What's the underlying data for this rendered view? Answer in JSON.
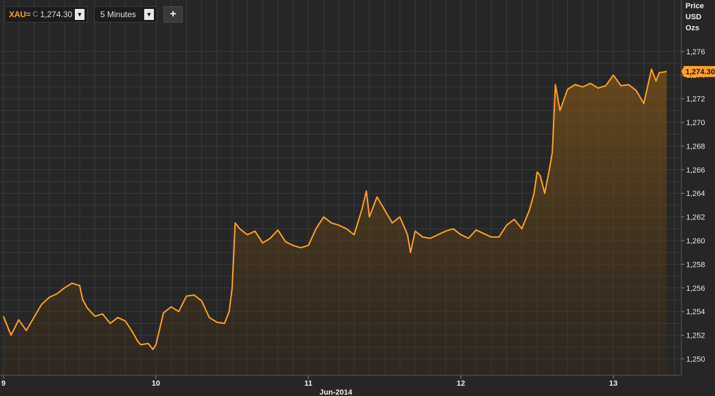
{
  "toolbar": {
    "ric": "XAU=",
    "closing_marker": "C",
    "last_price": "1,274.30",
    "interval": "5 Minutes",
    "add_label": "+"
  },
  "axis_header": {
    "line1": "Price",
    "line2": "USD",
    "line3": "Ozs"
  },
  "colors": {
    "line": "#ffa126",
    "background": "#262626",
    "grid": "#3a3a3a",
    "last_price_badge": "#ffa126"
  },
  "chart_data": {
    "type": "area",
    "title": "",
    "xlabel": "Jun-2014",
    "ylabel": "Price USD Ozs",
    "x_ticks": [
      "9",
      "10",
      "11",
      "12",
      "13"
    ],
    "ylim": [
      1249,
      1277
    ],
    "y_ticks": [
      "1,250",
      "1,252",
      "1,254",
      "1,256",
      "1,258",
      "1,260",
      "1,262",
      "1,264",
      "1,266",
      "1,268",
      "1,270",
      "1,272",
      "1,274",
      "1,276"
    ],
    "last_value": 1274.3,
    "last_value_label": "1,274.30",
    "grid": true,
    "series": [
      {
        "x": [
          9.0,
          9.05,
          9.1,
          9.15,
          9.2,
          9.25,
          9.3,
          9.35,
          9.4,
          9.45,
          9.5,
          9.52,
          9.55,
          9.6,
          9.65,
          9.7,
          9.75,
          9.8,
          9.85,
          9.88,
          9.9,
          9.95,
          9.98,
          10.0,
          10.05,
          10.1,
          10.15,
          10.2,
          10.25,
          10.3,
          10.35,
          10.4,
          10.45,
          10.48,
          10.5,
          10.52,
          10.55,
          10.6,
          10.65,
          10.7,
          10.75,
          10.8,
          10.85,
          10.9,
          10.95,
          11.0,
          11.05,
          11.1,
          11.15,
          11.2,
          11.25,
          11.3,
          11.35,
          11.38,
          11.4,
          11.45,
          11.5,
          11.55,
          11.6,
          11.65,
          11.67,
          11.7,
          11.75,
          11.8,
          11.85,
          11.9,
          11.95,
          12.0,
          12.05,
          12.1,
          12.15,
          12.2,
          12.25,
          12.3,
          12.35,
          12.4,
          12.45,
          12.48,
          12.5,
          12.52,
          12.55,
          12.58,
          12.6,
          12.62,
          12.65,
          12.7,
          12.75,
          12.8,
          12.85,
          12.9,
          12.95,
          13.0,
          13.05,
          13.1,
          13.15,
          13.2,
          13.25,
          13.28,
          13.3,
          13.35
        ],
        "values": [
          1253.6,
          1252.0,
          1253.3,
          1252.4,
          1253.5,
          1254.6,
          1255.2,
          1255.5,
          1256.0,
          1256.4,
          1256.2,
          1255.0,
          1254.3,
          1253.6,
          1253.8,
          1253.0,
          1253.5,
          1253.2,
          1252.2,
          1251.5,
          1251.2,
          1251.3,
          1250.8,
          1251.2,
          1253.9,
          1254.4,
          1254.0,
          1255.3,
          1255.4,
          1254.9,
          1253.5,
          1253.1,
          1253.0,
          1254.0,
          1256.0,
          1261.5,
          1261.0,
          1260.5,
          1260.8,
          1259.8,
          1260.2,
          1260.9,
          1259.9,
          1259.6,
          1259.4,
          1259.6,
          1261.0,
          1262.0,
          1261.5,
          1261.3,
          1261.0,
          1260.5,
          1262.6,
          1264.2,
          1262.0,
          1263.7,
          1262.6,
          1261.5,
          1262.0,
          1260.5,
          1259.0,
          1260.8,
          1260.3,
          1260.2,
          1260.5,
          1260.8,
          1261.0,
          1260.5,
          1260.2,
          1260.9,
          1260.6,
          1260.3,
          1260.3,
          1261.3,
          1261.8,
          1261.0,
          1262.6,
          1264.0,
          1265.8,
          1265.5,
          1264.0,
          1266.0,
          1267.5,
          1273.2,
          1271.0,
          1272.8,
          1273.2,
          1273.0,
          1273.3,
          1272.9,
          1273.1,
          1274.0,
          1273.1,
          1273.2,
          1272.7,
          1271.6,
          1274.5,
          1273.5,
          1274.2,
          1274.3
        ]
      }
    ]
  }
}
